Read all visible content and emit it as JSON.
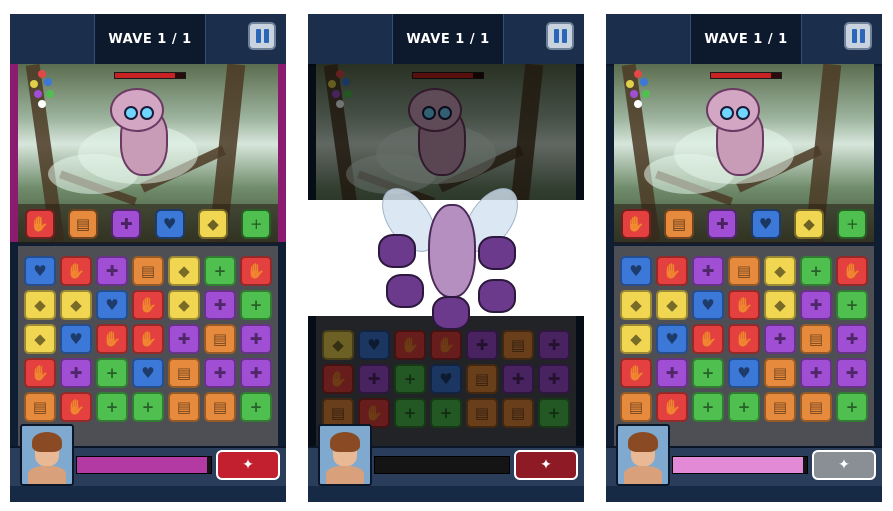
{
  "colors": {
    "red": "#e3403f",
    "orange": "#e68a3d",
    "purple": "#a04ed3",
    "blue": "#3b78d8",
    "yellow": "#f0d651",
    "green": "#4fc04f",
    "topbar": "#1b2f4d",
    "frame_magenta": "#8a1b6e"
  },
  "tile_icons": {
    "red": "✋",
    "orange": "▤",
    "purple": "✚",
    "blue": "♥",
    "yellow": "◆",
    "green": "+"
  },
  "gem_colors": [
    "#e34848",
    "#e0d04a",
    "#3b78d8",
    "#a04ed3",
    "#4fc04f",
    "#ffffff"
  ],
  "ability_colors": [
    "red",
    "orange",
    "purple",
    "blue",
    "yellow",
    "green"
  ],
  "panels": [
    {
      "wave_label": "WAVE 1 / 1",
      "state": "normal",
      "enemy_hp": 0.85,
      "meter": {
        "fill": 0.97,
        "color": "#b33aa3"
      },
      "ult_button": {
        "icon": "✦",
        "color": "#c21f2f",
        "ready": true
      },
      "board": [
        [
          "blue",
          "red",
          "purple",
          "orange",
          "yellow",
          "green",
          "red"
        ],
        [
          "yellow",
          "yellow",
          "blue",
          "red",
          "yellow",
          "purple",
          "green"
        ],
        [
          "yellow",
          "blue",
          "red",
          "red",
          "purple",
          "orange",
          "purple"
        ],
        [
          "red",
          "purple",
          "green",
          "blue",
          "orange",
          "purple",
          "purple"
        ],
        [
          "orange",
          "red",
          "green",
          "green",
          "orange",
          "orange",
          "green"
        ]
      ]
    },
    {
      "wave_label": "WAVE 1 / 1",
      "state": "enemy-attack",
      "enemy_hp": 0.85,
      "meter": {
        "fill": 0.0,
        "color": "#b33aa3"
      },
      "ult_button": {
        "icon": "✦",
        "color": "#8e1a26",
        "ready": true
      },
      "board": [
        [
          "yellow",
          "blue",
          "red",
          "red",
          "purple",
          "orange",
          "purple"
        ],
        [
          "red",
          "purple",
          "green",
          "blue",
          "orange",
          "purple",
          "purple"
        ],
        [
          "orange",
          "red",
          "green",
          "green",
          "orange",
          "orange",
          "green"
        ]
      ]
    },
    {
      "wave_label": "WAVE 1 / 1",
      "state": "normal",
      "enemy_hp": 0.85,
      "meter": {
        "fill": 0.97,
        "color": "#e28ad6"
      },
      "ult_button": {
        "icon": "✦",
        "color": "#8a8f96",
        "ready": false
      },
      "board": [
        [
          "blue",
          "red",
          "purple",
          "orange",
          "yellow",
          "green",
          "red"
        ],
        [
          "yellow",
          "yellow",
          "blue",
          "red",
          "yellow",
          "purple",
          "green"
        ],
        [
          "yellow",
          "blue",
          "red",
          "red",
          "purple",
          "orange",
          "purple"
        ],
        [
          "red",
          "purple",
          "green",
          "blue",
          "orange",
          "purple",
          "purple"
        ],
        [
          "orange",
          "red",
          "green",
          "green",
          "orange",
          "orange",
          "green"
        ]
      ]
    }
  ]
}
